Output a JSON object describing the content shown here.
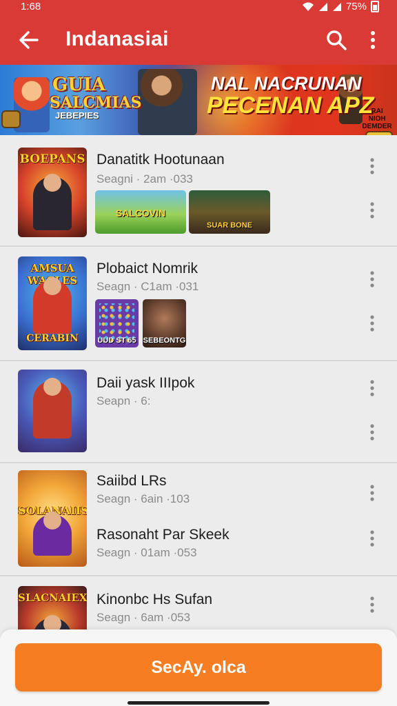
{
  "status_bar": {
    "time": "1:68",
    "battery": "75%"
  },
  "app_bar": {
    "title": "Indanasiai",
    "back_icon": "arrow-left-icon",
    "search_icon": "search-icon",
    "menu_icon": "more-vert-icon"
  },
  "banner": {
    "left_title_line1": "GUIA",
    "left_title_line2": "SALCMIAS",
    "left_title_line3": "JEBEPIES",
    "right_title_line1": "NAL NACRUNAN",
    "right_title_line2": "PECENAN APZ",
    "tag_lines": [
      "RAI",
      "NIOH",
      "DEMDER"
    ]
  },
  "items": [
    {
      "name": "Danatitk Hootunaan",
      "meta": "Seagni · 2am ·033",
      "thumb_title": "BOEPANS",
      "screens": [
        {
          "caption": "SALCOVIN"
        },
        {
          "caption": "SUAR BONE"
        }
      ]
    },
    {
      "name": "Plobaict Nomrik",
      "meta": "Seagn · C1am ·031",
      "thumb_title": "AMSUA WACLES",
      "thumb_sub": "CERABIN",
      "screens": [
        {
          "caption": "UUD ST 65"
        },
        {
          "caption": "SEBEONTG"
        }
      ]
    },
    {
      "name": "Daii yask IIIpok",
      "meta": "Seapn · 6:"
    },
    {
      "name": "Saiibd LRs",
      "meta": "Seagn · 6ain ·103",
      "thumb_title": "SOLANAIIS",
      "second_name": "Rasonaht Par Skeek",
      "second_meta": "Seagn · 01am ·053"
    },
    {
      "name": "Kinonbc Hs Sufan",
      "meta": "Seagn · 6am ·053",
      "thumb_title": "SLACNAIEX"
    }
  ],
  "cta": {
    "label": "SecAy. olca"
  },
  "colors": {
    "app_bar": "#d93a36",
    "cta": "#f57d22",
    "background": "#ececec"
  }
}
